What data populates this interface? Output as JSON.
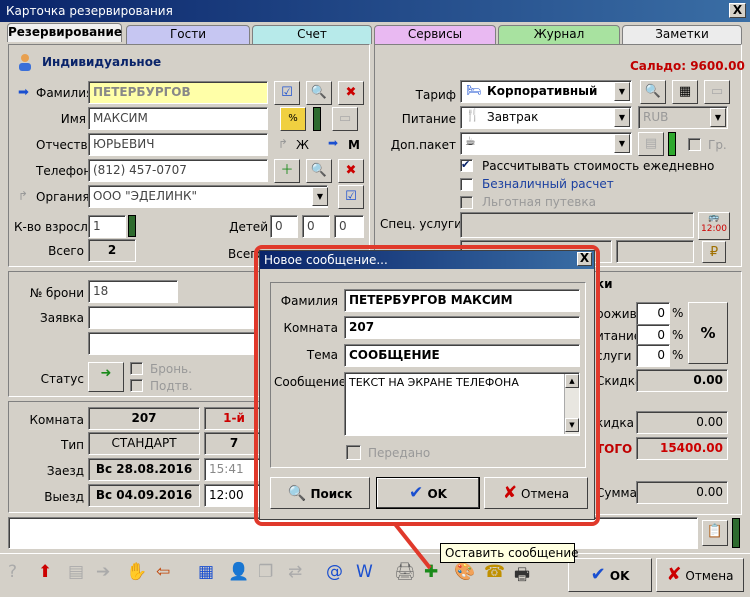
{
  "window": {
    "title": "Карточка резервирования",
    "close": "X"
  },
  "tabs": [
    {
      "label": "Резервирование",
      "color": "#f0f0f0"
    },
    {
      "label": "Гости",
      "color": "#c6c6f2"
    },
    {
      "label": "Счет",
      "color": "#b7eaea"
    },
    {
      "label": "Сервисы",
      "color": "#e9b9f2"
    },
    {
      "label": "Журнал",
      "color": "#a8e2a0"
    },
    {
      "label": "Заметки",
      "color": "#ececec"
    }
  ],
  "guest": {
    "type": "Индивидуальное",
    "lastname_label": "Фамилия",
    "lastname": "ПЕТЕРБУРГОВ",
    "firstname_label": "Имя",
    "firstname": "МАКСИМ",
    "middlename_label": "Отчество",
    "middlename": "ЮРЬЕВИЧ",
    "gender_f": "Ж",
    "gender_m": "М",
    "phone_label": "Телефон",
    "phone": "(812) 457-0707",
    "org_label": "Органия",
    "org": "ООО \"ЭДЕЛИНК\"",
    "adults_label": "К-во взросл.",
    "adults": "1",
    "children_label": "Детей",
    "children": [
      "0",
      "0",
      "0"
    ],
    "total_label": "Всего",
    "total": "2",
    "total2_label": "Всего"
  },
  "booking": {
    "number_label": "№ брони",
    "number": "18",
    "request_label": "Заявка",
    "status_label": "Статус",
    "brone": "Бронь.",
    "podtv": "Подтв."
  },
  "room": {
    "room_label": "Комната",
    "room": "207",
    "floor": "1-й",
    "type_label": "Тип",
    "type": "СТАНДАРТ",
    "type_num": "7",
    "checkin_label": "Заезд",
    "checkin": "Вс 28.08.2016",
    "checkin_time": "15:41",
    "checkout_label": "Выезд",
    "checkout": "Вс 04.09.2016",
    "checkout_time": "12:00"
  },
  "right": {
    "saldo": "Сальдо: 9600.00",
    "tariff_label": "Тариф",
    "tariff": "Корпоративный",
    "food_label": "Питание",
    "food": "Завтрак",
    "currency": "RUB",
    "dop_label": "Доп.пакет",
    "gr": "Гр.",
    "daily": "Рассчитывать стоимость ежедневно",
    "cashless": "Безналичный расчет",
    "privilege": "Льготная путевка",
    "spec_label": "Спец. услуги",
    "bus_time": "12:00",
    "tki": "ки",
    "prozh_label": "рожив.",
    "prozh": "0",
    "pitanie_label": "итание",
    "pitanie": "0",
    "uslugi_label": "слуги",
    "uslugi": "0",
    "percent_sign": "%",
    "percent_btn": "%",
    "skidka_label": "Скидка",
    "skidka": "0.00",
    "skidka2_label": "кидка",
    "skidka2": "0.00",
    "itogo_label": "ТОГО",
    "itogo": "15400.00",
    "summa_label": "Сумма",
    "summa": "0.00"
  },
  "dialog": {
    "title": "Новое сообщение...",
    "close": "X",
    "lastname_label": "Фамилия",
    "lastname": "ПЕТЕРБУРГОВ МАКСИМ",
    "room_label": "Комната",
    "room": "207",
    "topic_label": "Тема",
    "topic": "СООБЩЕНИЕ",
    "message_label": "Сообщение",
    "message": "ТЕКСТ НА ЭКРАНЕ ТЕЛЕФОНА",
    "sent_label": "Передано",
    "search_btn": "Поиск",
    "ok_btn": "OK",
    "cancel_btn": "Отмена"
  },
  "tooltip": "Оставить сообщение",
  "footer": {
    "ok": "OK",
    "cancel": "Отмена"
  },
  "colors": {
    "accent": "#0a246a",
    "highlight": "#ffffa8",
    "red": "#c00000",
    "callout": "#e0392b"
  }
}
